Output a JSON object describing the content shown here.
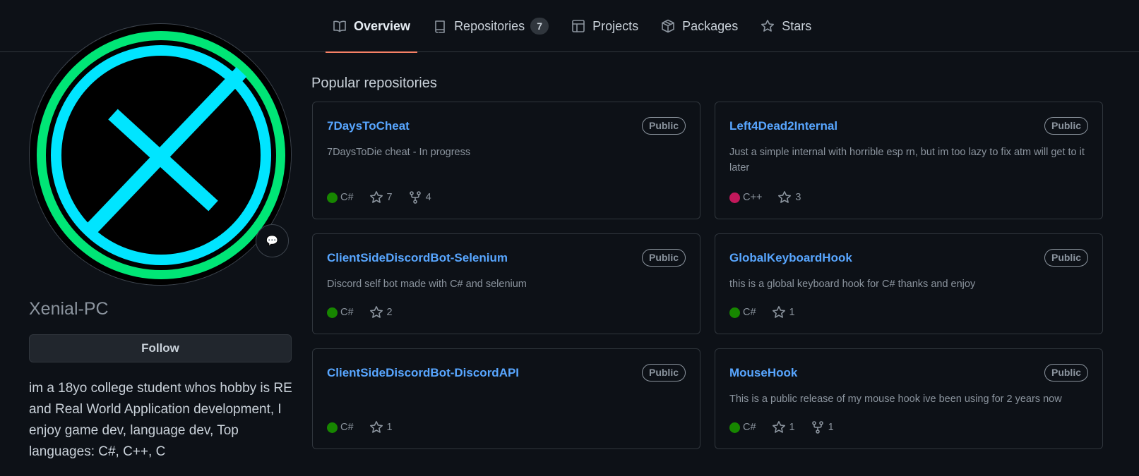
{
  "nav": {
    "tabs": [
      {
        "label": "Overview",
        "icon": "book-icon"
      },
      {
        "label": "Repositories",
        "icon": "repo-icon",
        "count": "7"
      },
      {
        "label": "Projects",
        "icon": "table-icon"
      },
      {
        "label": "Packages",
        "icon": "package-icon"
      },
      {
        "label": "Stars",
        "icon": "star-icon"
      }
    ]
  },
  "profile": {
    "username": "Xenial-PC",
    "follow_label": "Follow",
    "bio": "im a 18yo college student whos hobby is RE and Real World Application development, I enjoy game dev, language dev, Top languages: C#, C++, C",
    "status_icon": "💬"
  },
  "popular": {
    "title": "Popular repositories",
    "repos": [
      {
        "name": "7DaysToCheat",
        "visibility": "Public",
        "description": "7DaysToDie cheat - In progress",
        "language": "C#",
        "lang_color": "#178600",
        "stars": "7",
        "forks": "4"
      },
      {
        "name": "Left4Dead2Internal",
        "visibility": "Public",
        "description": "Just a simple internal with horrible esp rn, but im too lazy to fix atm will get to it later",
        "language": "C++",
        "lang_color": "#f34b7d",
        "stars": "3",
        "forks": ""
      },
      {
        "name": "ClientSideDiscordBot-Selenium",
        "visibility": "Public",
        "description": "Discord self bot made with C# and selenium",
        "language": "C#",
        "lang_color": "#178600",
        "stars": "2",
        "forks": ""
      },
      {
        "name": "GlobalKeyboardHook",
        "visibility": "Public",
        "description": "this is a global keyboard hook for C# thanks and enjoy",
        "language": "C#",
        "lang_color": "#178600",
        "stars": "1",
        "forks": ""
      },
      {
        "name": "ClientSideDiscordBot-DiscordAPI",
        "visibility": "Public",
        "description": "",
        "language": "C#",
        "lang_color": "#178600",
        "stars": "1",
        "forks": ""
      },
      {
        "name": "MouseHook",
        "visibility": "Public",
        "description": "This is a public release of my mouse hook ive been using for 2 years now",
        "language": "C#",
        "lang_color": "#178600",
        "stars": "1",
        "forks": "1"
      }
    ]
  },
  "colors": {
    "background": "#0d1117",
    "link": "#58a6ff",
    "active_tab_underline": "#f78166",
    "avatar_green": "#00e676",
    "avatar_cyan": "#00e5ff"
  }
}
